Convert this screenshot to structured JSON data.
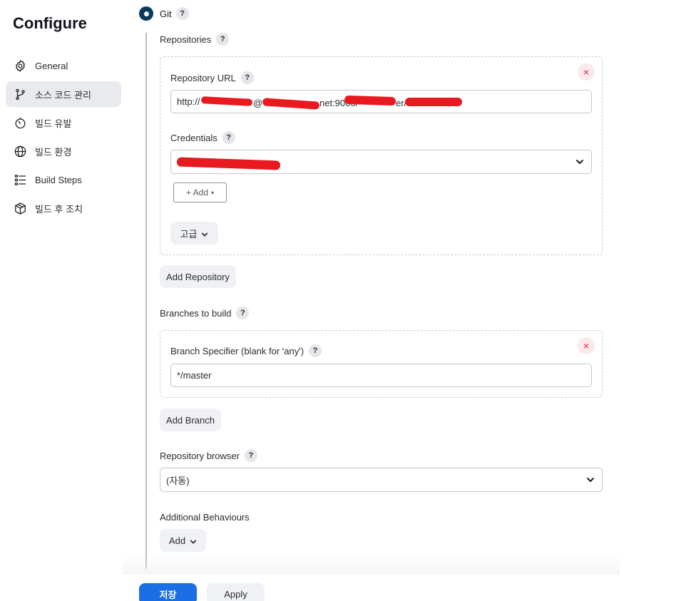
{
  "page_title": "Configure",
  "sidebar": {
    "items": [
      {
        "label": "General",
        "icon": "gear-icon"
      },
      {
        "label": "소스 코드 관리",
        "icon": "source-branch-icon",
        "active": true
      },
      {
        "label": "빌드 유발",
        "icon": "timer-icon"
      },
      {
        "label": "빌드 환경",
        "icon": "globe-icon"
      },
      {
        "label": "Build Steps",
        "icon": "list-steps-icon"
      },
      {
        "label": "빌드 후 조치",
        "icon": "package-icon"
      }
    ]
  },
  "scm": {
    "option_label": "Git",
    "help": "?",
    "repositories_label": "Repositories",
    "repository_url_label": "Repository URL",
    "repository_url_visible_fragments": [
      "http://",
      "@",
      "net:9000/",
      "er/"
    ],
    "credentials_label": "Credentials",
    "add_credentials_label": "+ Add",
    "advanced_label": "고급",
    "add_repository_label": "Add Repository",
    "branches_label": "Branches to build",
    "branch_specifier_label": "Branch Specifier (blank for 'any')",
    "branch_specifier_value": "*/master",
    "add_branch_label": "Add Branch",
    "repository_browser_label": "Repository browser",
    "repository_browser_value": "(자동)",
    "additional_behaviours_label": "Additional Behaviours",
    "add_label": "Add",
    "remove_symbol": "×"
  },
  "footer": {
    "save_label": "저장",
    "apply_label": "Apply"
  },
  "colors": {
    "primary": "#1b6ee5",
    "radio": "#0a3a5c",
    "redaction": "#e8191f",
    "danger": "#d0243a"
  }
}
